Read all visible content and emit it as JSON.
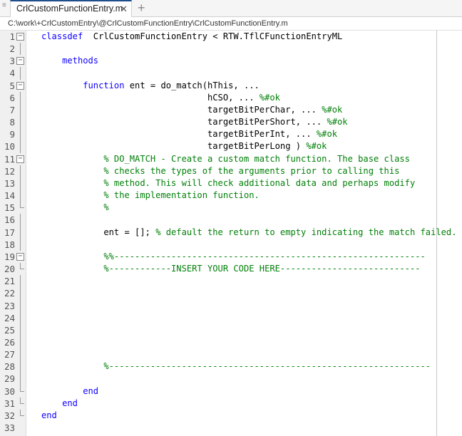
{
  "tab": {
    "title": "CrlCustomFunctionEntry.m",
    "close_icon": "close-icon",
    "add_icon": "plus-icon"
  },
  "path": "C:\\work\\+CrlCustomEntry\\@CrlCustomFunctionEntry\\CrlCustomFunctionEntry.m",
  "colors": {
    "keyword": "#0e00ff",
    "comment": "#028009",
    "tab_accent": "#1f4e8c"
  },
  "lines": [
    {
      "n": "1",
      "fold": "open",
      "parts": [
        [
          "kw",
          "classdef"
        ],
        [
          "",
          "  CrlCustomFunctionEntry < RTW.TflCFunctionEntryML"
        ]
      ]
    },
    {
      "n": "2",
      "fold": "line",
      "parts": []
    },
    {
      "n": "3",
      "fold": "open",
      "parts": [
        [
          "",
          "    "
        ],
        [
          "kw",
          "methods"
        ]
      ]
    },
    {
      "n": "4",
      "fold": "line",
      "parts": []
    },
    {
      "n": "5",
      "fold": "open",
      "parts": [
        [
          "",
          "        "
        ],
        [
          "kw",
          "function"
        ],
        [
          "",
          " ent = do_match(hThis, ..."
        ]
      ]
    },
    {
      "n": "6",
      "fold": "line",
      "parts": [
        [
          "",
          "                                hCSO, ... "
        ],
        [
          "cm",
          "%#ok"
        ]
      ]
    },
    {
      "n": "7",
      "fold": "line",
      "parts": [
        [
          "",
          "                                targetBitPerChar, ... "
        ],
        [
          "cm",
          "%#ok"
        ]
      ]
    },
    {
      "n": "8",
      "fold": "line",
      "parts": [
        [
          "",
          "                                targetBitPerShort, ... "
        ],
        [
          "cm",
          "%#ok"
        ]
      ]
    },
    {
      "n": "9",
      "fold": "line",
      "parts": [
        [
          "",
          "                                targetBitPerInt, ... "
        ],
        [
          "cm",
          "%#ok"
        ]
      ]
    },
    {
      "n": "10",
      "fold": "line",
      "parts": [
        [
          "",
          "                                targetBitPerLong ) "
        ],
        [
          "cm",
          "%#ok"
        ]
      ]
    },
    {
      "n": "11",
      "fold": "open",
      "parts": [
        [
          "",
          "            "
        ],
        [
          "cm",
          "% DO_MATCH - Create a custom match function. The base class"
        ]
      ]
    },
    {
      "n": "12",
      "fold": "line",
      "parts": [
        [
          "",
          "            "
        ],
        [
          "cm",
          "% checks the types of the arguments prior to calling this"
        ]
      ]
    },
    {
      "n": "13",
      "fold": "line",
      "parts": [
        [
          "",
          "            "
        ],
        [
          "cm",
          "% method. This will check additional data and perhaps modify"
        ]
      ]
    },
    {
      "n": "14",
      "fold": "line",
      "parts": [
        [
          "",
          "            "
        ],
        [
          "cm",
          "% the implementation function."
        ]
      ]
    },
    {
      "n": "15",
      "fold": "end",
      "parts": [
        [
          "",
          "            "
        ],
        [
          "cm",
          "%"
        ]
      ]
    },
    {
      "n": "16",
      "fold": "line",
      "parts": []
    },
    {
      "n": "17",
      "fold": "line",
      "parts": [
        [
          "",
          "            ent = []; "
        ],
        [
          "cm",
          "% default the return to empty indicating the match failed."
        ]
      ]
    },
    {
      "n": "18",
      "fold": "line",
      "parts": []
    },
    {
      "n": "19",
      "fold": "open",
      "parts": [
        [
          "",
          "            "
        ],
        [
          "cell",
          "%%------------------------------------------------------------"
        ]
      ]
    },
    {
      "n": "20",
      "fold": "end",
      "parts": [
        [
          "",
          "            "
        ],
        [
          "cm",
          "%------------INSERT YOUR CODE HERE---------------------------"
        ]
      ]
    },
    {
      "n": "21",
      "fold": "line",
      "parts": []
    },
    {
      "n": "22",
      "fold": "line",
      "parts": []
    },
    {
      "n": "23",
      "fold": "line",
      "parts": []
    },
    {
      "n": "24",
      "fold": "line",
      "parts": []
    },
    {
      "n": "25",
      "fold": "line",
      "parts": []
    },
    {
      "n": "26",
      "fold": "line",
      "parts": []
    },
    {
      "n": "27",
      "fold": "line",
      "parts": []
    },
    {
      "n": "28",
      "fold": "line",
      "parts": [
        [
          "",
          "            "
        ],
        [
          "cm",
          "%--------------------------------------------------------------"
        ]
      ]
    },
    {
      "n": "29",
      "fold": "line",
      "parts": []
    },
    {
      "n": "30",
      "fold": "end",
      "parts": [
        [
          "",
          "        "
        ],
        [
          "kw",
          "end"
        ]
      ]
    },
    {
      "n": "31",
      "fold": "end",
      "parts": [
        [
          "",
          "    "
        ],
        [
          "kw",
          "end"
        ]
      ]
    },
    {
      "n": "32",
      "fold": "end",
      "parts": [
        [
          "kw",
          "end"
        ]
      ]
    },
    {
      "n": "33",
      "fold": "",
      "parts": []
    }
  ]
}
